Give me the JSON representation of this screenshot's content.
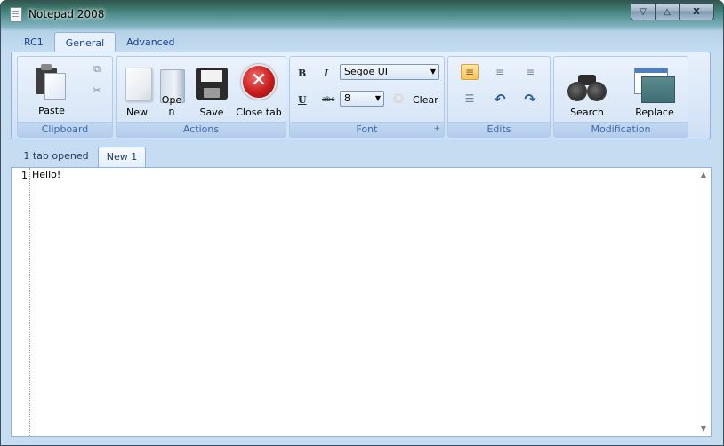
{
  "window": {
    "title": "Notepad 2008"
  },
  "caption": {
    "minimize": "▽",
    "restore": "△",
    "close": "X"
  },
  "ribbon_tabs": [
    {
      "label": "RC1"
    },
    {
      "label": "General",
      "active": true
    },
    {
      "label": "Advanced"
    }
  ],
  "groups": {
    "clipboard": {
      "label": "Clipboard",
      "paste": "Paste",
      "copy_icon": "copy-icon",
      "cut_icon": "cut-icon"
    },
    "actions": {
      "label": "Actions",
      "new": "New",
      "open": "Ope\nn",
      "save": "Save",
      "close_tab": "Close tab"
    },
    "font": {
      "label": "Font",
      "bold": "B",
      "italic": "I",
      "underline": "U",
      "strike": "abc",
      "font_name": "Segoe UI",
      "font_size": "8",
      "clear": "Clear",
      "launcher": "+"
    },
    "edits": {
      "label": "Edits"
    },
    "modification": {
      "label": "Modification",
      "search": "Search",
      "replace": "Replace"
    }
  },
  "doc_tabs": {
    "info": "1 tab opened",
    "tabs": [
      {
        "label": "New 1",
        "active": true
      }
    ]
  },
  "editor": {
    "line_number": "1",
    "text": "Hello!"
  },
  "colors": {
    "accent": "#8db2e3",
    "ribbon_bg": "#dbe8f7",
    "group_label": "#3e6aaa",
    "active_align": "#f8c45f"
  }
}
